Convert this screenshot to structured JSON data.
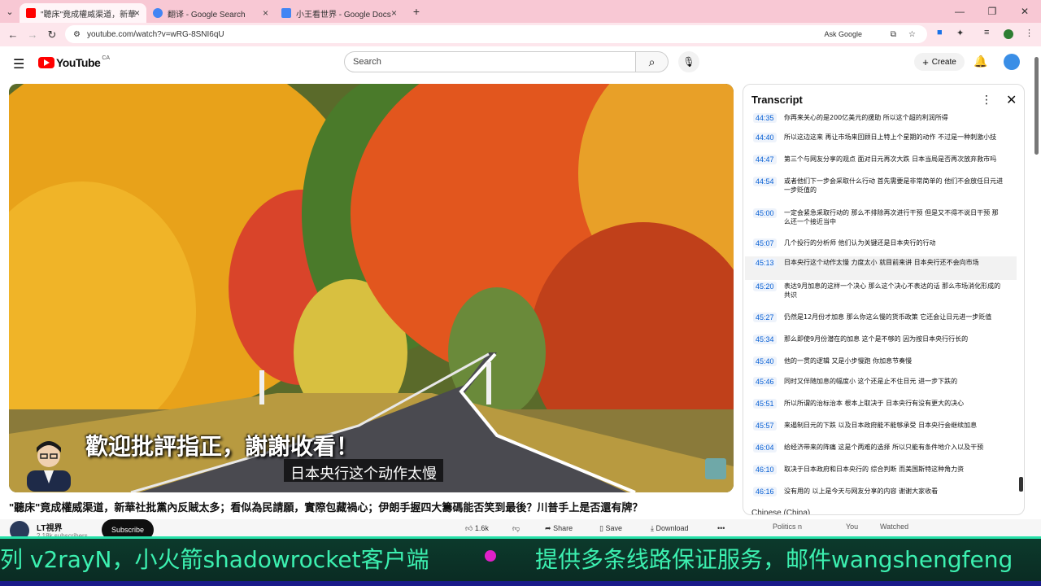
{
  "browser": {
    "tabs": [
      {
        "title": "\"聽床\"竟成權威渠道，新華",
        "active": true,
        "favicon_color": "#ff0000"
      },
      {
        "title": "翻译 - Google Search",
        "active": false,
        "favicon_color": "#4285f4"
      },
      {
        "title": "小王看世界 - Google Docs",
        "active": false,
        "favicon_color": "#4285f4"
      }
    ],
    "new_tab": "+",
    "url": "youtube.com/watch?v=wRG-8SNI6qU",
    "ask_google": "Ask Google"
  },
  "youtube": {
    "logo": "YouTube",
    "country": "CA",
    "search_placeholder": "Search",
    "create_label": "Create"
  },
  "video": {
    "subtitle_burned": "歡迎批評指正，謝謝收看！",
    "caption": "日本央行这个动作太慢",
    "title": "\"聽床\"竟成權威渠道，新華社批黨內反賊太多；看似為民請願，實際包藏禍心；伊朗手握四大籌碼能否笑到最後？川普手上是否還有牌？",
    "channel_name": "LT視界",
    "channel_subs": "2.18k subscribers",
    "subscribe_label": "Subscribe",
    "likes": "1.6k",
    "share_label": "Share",
    "save_label": "Save",
    "download_label": "Download",
    "chip_politics": "Politics n",
    "chip_you": "You",
    "chip_watched": "Watched"
  },
  "transcript": {
    "title": "Transcript",
    "language": "Chinese (China)",
    "segments": [
      {
        "time": "44:35",
        "text": "你再来关心的是200亿美元的援助 所以这个超的利润所得"
      },
      {
        "time": "44:40",
        "text": "所以这边这来 再让市场来回顾日上特上个星期的动作 不过是一种刺激小技"
      },
      {
        "time": "44:47",
        "text": "第三个与网友分享的观点 面对日元再次大跌 日本当局是否再次放弃救市吗"
      },
      {
        "time": "44:54",
        "text": "或者他们下一步会采取什么行动 首先需要是非常简单的 他们不会放任日元进一步贬值的"
      },
      {
        "time": "45:00",
        "text": "一定会紧急采取行动的 那么不排除再次进行干预 但是又不得不说日干预 那么还一个接近当中"
      },
      {
        "time": "45:07",
        "text": "几个投行的分析师 他们认为关键还是日本央行的行动"
      },
      {
        "time": "45:13",
        "text": "日本央行这个动作太慢 力度太小 就目前来讲 日本央行还不会向市场"
      },
      {
        "time": "45:20",
        "text": "表达9月加息的这样一个决心 那么这个决心不表达的话 那么市场消化形成的共识"
      },
      {
        "time": "45:27",
        "text": "仍然是12月份才加息 那么你这么慢的货币政策 它还会让日元进一步贬值"
      },
      {
        "time": "45:34",
        "text": "那么即使9月份潜在的加息 这个是不够的 因为按日本央行行长的"
      },
      {
        "time": "45:40",
        "text": "他的一贯的逻辑 又是小步慢跑 你加息节奏慢"
      },
      {
        "time": "45:46",
        "text": "同时又伴随加息的幅度小 这个还是止不住日元 进一步下跌的"
      },
      {
        "time": "45:51",
        "text": "所以所谓的治标治本 根本上取决于 日本央行有没有更大的决心"
      },
      {
        "time": "45:57",
        "text": "来遏制日元的下跌 以及日本政府能不能够承受 日本央行会继续加息"
      },
      {
        "time": "46:04",
        "text": "给经济带来的阵痛 这是个两难的选择 所以只能有条件地介入以及干预"
      },
      {
        "time": "46:10",
        "text": "取决于日本政府和日本央行的 综合判断 而美国斯特这种角力资"
      },
      {
        "time": "46:16",
        "text": "没有用的 以上是今天与网友分享的内容 谢谢大家收看"
      }
    ]
  },
  "banner": {
    "left_text": "列 v2rayN，小火箭shadowrocket客户端",
    "right_text": "提供多条线路保证服务，邮件wangshengfeng"
  }
}
